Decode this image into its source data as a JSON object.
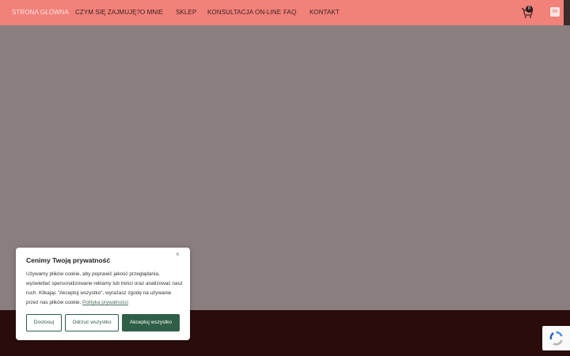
{
  "nav": {
    "items": [
      {
        "label": "STRONA GŁÓWNA",
        "active": true
      },
      {
        "label": "CZYM SIĘ ZAJMUJĘ?"
      },
      {
        "label": "O MNIE"
      },
      {
        "label": "SKLEP"
      },
      {
        "label": "KONSULTACJA ON-LINE"
      },
      {
        "label": "FAQ"
      },
      {
        "label": "KONTAKT"
      }
    ],
    "cart_count": "0",
    "linkedin_glyph": "in"
  },
  "cookie": {
    "title": "Cenimy Twoją prywatność",
    "close": "×",
    "body": "Używamy plików cookie, aby poprawić jakość przeglądania, wyświetlać spersonalizowane reklamy lub treści oraz analizować nasz ruch. Klikając \"Akceptuj wszystko\", wyrażasz zgodę na używanie przez nas plików cookie.",
    "policy_link": "Polityka prywatności",
    "buttons": {
      "customize": "Dostosuj",
      "reject": "Odrzuć wszystko",
      "accept": "Akceptuj wszystko"
    }
  },
  "colors": {
    "nav_bg": "#f2817a",
    "hero_bg": "#8a7e7f",
    "footer_bg": "#2a0d0b",
    "accent_green": "#2f5f47"
  }
}
